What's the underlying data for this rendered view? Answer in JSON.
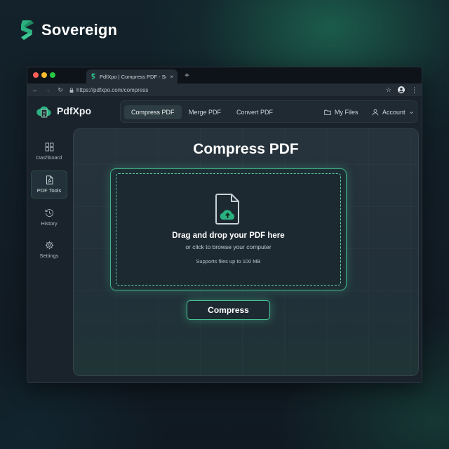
{
  "brand": {
    "name": "Sovereign",
    "logo_icon": "sovereign-s-logo-icon",
    "accent": "#2bb07f"
  },
  "browser": {
    "tab_title": "PdfXpo | Compress PDF - Sovereign",
    "tab_close": "×",
    "new_tab": "+",
    "url": "https://pdfxpo.com/compress",
    "back": "←",
    "forward": "→",
    "reload": "↻",
    "bookmark": "☆",
    "menu": "⋮"
  },
  "app": {
    "name": "PdfXpo",
    "nav": [
      {
        "label": "Compress PDF",
        "active": true
      },
      {
        "label": "Merge PDF"
      },
      {
        "label": "Convert PDF"
      }
    ],
    "my_files": "My Files",
    "account": "Account"
  },
  "sidebar": {
    "items": [
      {
        "label": "Dashboard",
        "icon": "grid-icon"
      },
      {
        "label": "PDF Tools",
        "icon": "pdf-file-icon",
        "active": true
      },
      {
        "label": "History",
        "icon": "history-icon"
      },
      {
        "label": "Settings",
        "icon": "gear-icon"
      }
    ]
  },
  "main": {
    "title": "Compress PDF",
    "dropzone": {
      "title": "Drag and drop your PDF here",
      "subtitle": "or click to browse your computer",
      "note": "Supports files up to 100 MB"
    },
    "compress_button": "Compress"
  }
}
